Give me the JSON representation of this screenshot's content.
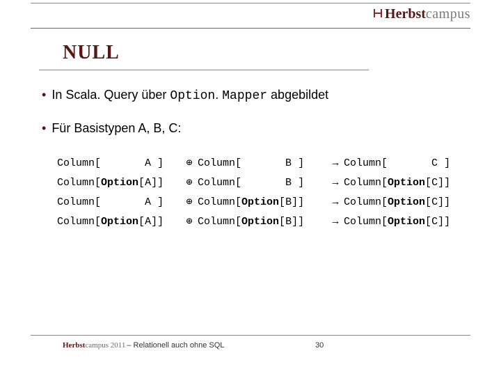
{
  "brand": {
    "strong": "Herbst",
    "light": "campus"
  },
  "title": "NULL",
  "bullets": {
    "b1_pre": "In Scala",
    "b1_mid1": ". Query über ",
    "b1_code1": "Option",
    "b1_mid2": ". ",
    "b1_code2": "Mapper",
    "b1_post": " abgebildet",
    "b2": "Für Basistypen A, B, C:"
  },
  "ops": {
    "plus": "⊕",
    "arrow": "→"
  },
  "tokens": {
    "column": "Column",
    "option": "Option",
    "lb": "[",
    "rb": "]",
    "sp": " ",
    "A": "A",
    "B": "B",
    "C": "C"
  },
  "footer": {
    "brand_strong": "Herbst",
    "brand_rest": "campus 2011",
    "subtitle": " – Relationell auch ohne SQL",
    "page": "30"
  }
}
